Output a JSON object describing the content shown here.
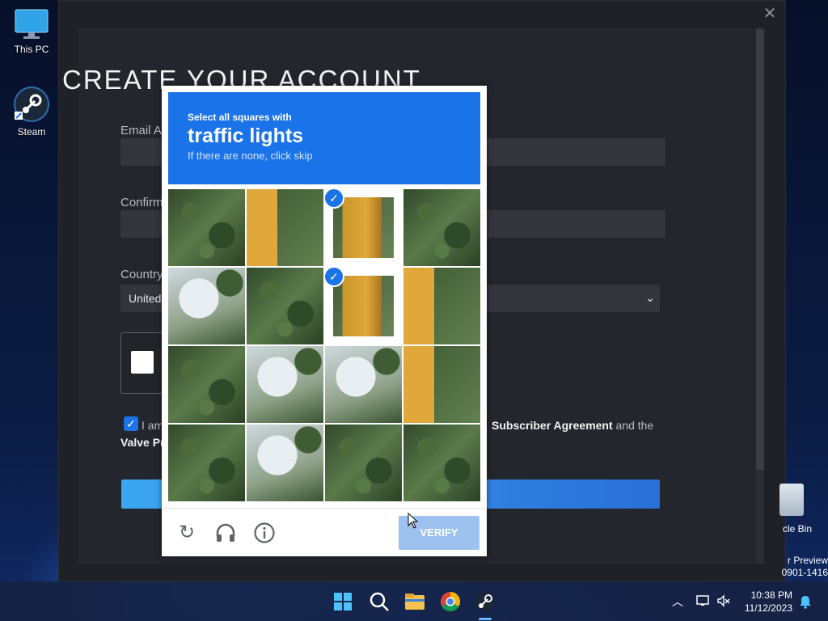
{
  "desktop": {
    "icons": [
      {
        "label": "This PC",
        "icon": "monitor-icon"
      },
      {
        "label": "Steam",
        "icon": "steam-icon"
      }
    ],
    "recycle_bin_label": "cle Bin",
    "build_line1": "r Preview",
    "build_line2": "0901-1416"
  },
  "steam_window": {
    "close_glyph": "✕",
    "title": "CREATE YOUR ACCOUNT",
    "email_label": "Email Ac",
    "confirm_label": "Confirm",
    "country_label": "Country",
    "country_value": "United",
    "select_chevron": "⌄",
    "agree_prefix": "I am",
    "agree_suffix_bold": "Subscriber Agreement",
    "agree_suffix_rest": " and the",
    "agree_line2_bold": "Valve Pr",
    "agree_checked": true
  },
  "captcha": {
    "instruction": "Select all squares with",
    "target": "traffic lights",
    "hint": "If there are none, click skip",
    "tiles": [
      {
        "row": 1,
        "col": 1,
        "scene": "tree",
        "selected": false
      },
      {
        "row": 1,
        "col": 2,
        "scene": "light-part",
        "selected": false
      },
      {
        "row": 1,
        "col": 3,
        "scene": "light",
        "selected": true
      },
      {
        "row": 1,
        "col": 4,
        "scene": "tree",
        "selected": false
      },
      {
        "row": 2,
        "col": 1,
        "scene": "sky",
        "selected": false
      },
      {
        "row": 2,
        "col": 2,
        "scene": "tree",
        "selected": false
      },
      {
        "row": 2,
        "col": 3,
        "scene": "light",
        "selected": true
      },
      {
        "row": 2,
        "col": 4,
        "scene": "light-part",
        "selected": false
      },
      {
        "row": 3,
        "col": 1,
        "scene": "tree",
        "selected": false
      },
      {
        "row": 3,
        "col": 2,
        "scene": "sky",
        "selected": false
      },
      {
        "row": 3,
        "col": 3,
        "scene": "sky",
        "selected": false
      },
      {
        "row": 3,
        "col": 4,
        "scene": "light-part",
        "selected": false
      },
      {
        "row": 4,
        "col": 1,
        "scene": "tree",
        "selected": false
      },
      {
        "row": 4,
        "col": 2,
        "scene": "sky",
        "selected": false
      },
      {
        "row": 4,
        "col": 3,
        "scene": "tree",
        "selected": false
      },
      {
        "row": 4,
        "col": 4,
        "scene": "tree",
        "selected": false
      }
    ],
    "check_glyph": "✓",
    "reload_glyph": "↻",
    "audio_glyph": "🎧",
    "info_glyph": "ⓘ",
    "verify_label": "VERIFY",
    "accent": "#1a73e8",
    "verify_color_disabled": "#9dc2f0"
  },
  "taskbar": {
    "apps": [
      "start-icon",
      "search-icon",
      "file-explorer-icon",
      "chrome-icon",
      "steam-icon"
    ],
    "active_app": "steam-icon",
    "tray_chevron": "︿",
    "time": "10:38 PM",
    "date": "11/12/2023",
    "notification_glyph": "🔔"
  }
}
